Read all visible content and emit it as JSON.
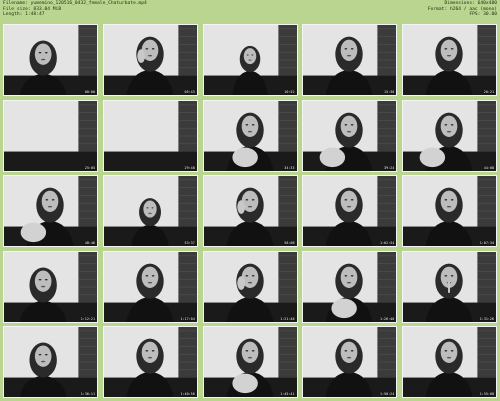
{
  "header": {
    "filename": "Filename: yumemino_120516_0432_female_Chaturbate.mp4",
    "filesize": "File size: 833.04 MiB",
    "length": "Length: 1:48:47",
    "dimensions": "Dimensions: 640x480",
    "format": "Format: h264 / aac (mono)",
    "fps": "FPS: 30.00"
  },
  "thumbnails": [
    {
      "time": "00:00",
      "scene": "lean-left"
    },
    {
      "time": "05:43",
      "scene": "hand-cheek"
    },
    {
      "time": "10:52",
      "scene": "small-center"
    },
    {
      "time": "15:30",
      "scene": "center-tall"
    },
    {
      "time": "20:21",
      "scene": "center-tall"
    },
    {
      "time": "25:05",
      "scene": "empty-wall"
    },
    {
      "time": "29:48",
      "scene": "empty-wall"
    },
    {
      "time": "34:33",
      "scene": "knee"
    },
    {
      "time": "39:24",
      "scene": "knee-small"
    },
    {
      "time": "44:08",
      "scene": "knee-small"
    },
    {
      "time": "48:46",
      "scene": "knee-small"
    },
    {
      "time": "53:37",
      "scene": "low-center"
    },
    {
      "time": "58:08",
      "scene": "hand-face"
    },
    {
      "time": "1:02:54",
      "scene": "center-tall"
    },
    {
      "time": "1:07:34",
      "scene": "center-tall"
    },
    {
      "time": "1:12:21",
      "scene": "lean-left"
    },
    {
      "time": "1:17:04",
      "scene": "center-tall"
    },
    {
      "time": "1:21:48",
      "scene": "hand-cheek"
    },
    {
      "time": "1:26:40",
      "scene": "knee"
    },
    {
      "time": "1:31:26",
      "scene": "finger-lip"
    },
    {
      "time": "1:36:11",
      "scene": "lean-left"
    },
    {
      "time": "1:40:56",
      "scene": "center-tall"
    },
    {
      "time": "1:45:41",
      "scene": "knee"
    },
    {
      "time": "1:50:24",
      "scene": "center-tall"
    },
    {
      "time": "1:55:08",
      "scene": "center-tall"
    }
  ],
  "colors": {
    "background": "#b9d58f",
    "wall": "#e4e4e4",
    "brick": "#3b3b3b",
    "hair": "#2a2a2a",
    "skin": "#bdbdbd",
    "clothing": "#111111"
  }
}
